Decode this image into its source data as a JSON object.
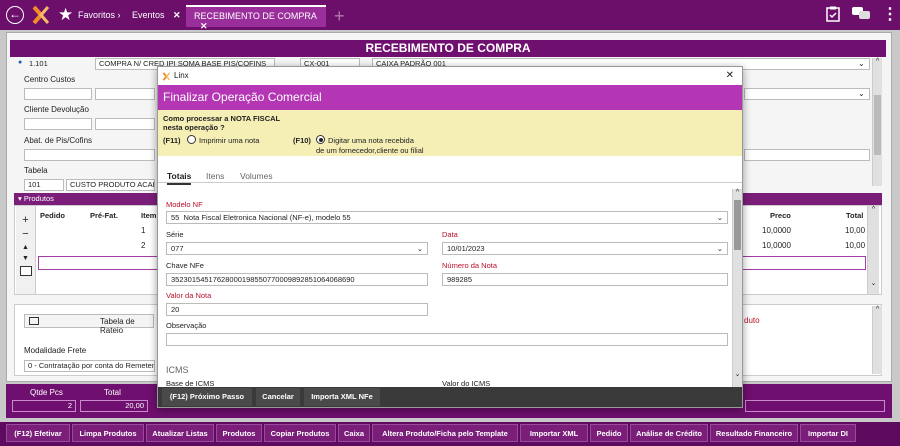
{
  "topbar": {
    "favoritos": "Favoritos",
    "favoritos_arrow": "›",
    "eventos": "Eventos",
    "tab_active": "RECEBIMENTO DE COMPRA",
    "tab_close": "✕",
    "eventos_close": "✕",
    "plus": "+"
  },
  "main": {
    "title": "RECEBIMENTO DE COMPRA",
    "row1": {
      "code": "1.101",
      "operacao": "COMPRA N/ CRED IPI SOMA BASE PIS/COFINS",
      "caixa_code": "CX-001",
      "caixa_name": "CAIXA PADRÃO 001"
    },
    "labels": {
      "centro_custos": "Centro Custos",
      "cliente_devolucao": "Cliente Devolução",
      "abat": "Abat. de Pis/Cofins",
      "tabela": "Tabela",
      "modalidade": "Modalidade Frete",
      "tabela_rateio": "Tabela de Rateio",
      "produto": "duto"
    },
    "tabela_code": "101",
    "tabela_name": "CUSTO PRODUTO ACABADO",
    "modalidade_value": "0 - Contratação por conta do Remetente (CIF)",
    "produtos": {
      "header": "Produtos",
      "columns": {
        "pedido": "Pedido",
        "prefat": "Pré-Fat.",
        "item": "Item",
        "preco": "Preco",
        "total": "Total"
      },
      "rows": [
        {
          "item": "1",
          "preco": "10,0000",
          "total": "10,00"
        },
        {
          "item": "2",
          "preco": "10,0000",
          "total": "10,00"
        }
      ]
    },
    "totals": {
      "qtde_label": "Qtde Pcs",
      "qtde_value": "2",
      "total_label": "Total",
      "total_value": "20,00"
    }
  },
  "modal": {
    "app": "Linx",
    "close": "✕",
    "header": "Finalizar Operação Comercial",
    "question_l1": "Como processar a NOTA FISCAL",
    "question_l2": "nesta operação ?",
    "opt1_key": "(F11)",
    "opt1_label": "Imprimir uma nota",
    "opt2_key": "(F10)",
    "opt2_l1": "Digitar uma nota recebida",
    "opt2_l2": "de um fornecedor,cliente ou filial",
    "tabs": [
      "Totais",
      "Itens",
      "Volumes"
    ],
    "fields": {
      "modelo_label": "Modelo NF",
      "modelo_code": "55",
      "modelo_value": "Nota Fiscal Eletronica Nacional (NF-e), modelo 55",
      "serie_label": "Série",
      "serie_value": "077",
      "data_label": "Data",
      "data_value": "10/01/2023",
      "chave_label": "Chave NFe",
      "chave_value": "35230154517628000198550770009892851064068690",
      "numero_label": "Número da Nota",
      "numero_value": "989285",
      "valor_label": "Valor da Nota",
      "valor_value": "20",
      "obs_label": "Observação",
      "icms_section": "ICMS",
      "base_icms": "Base de ICMS",
      "valor_icms": "Valor do ICMS"
    },
    "buttons": {
      "proximo": "(F12) Próximo Passo",
      "cancelar": "Cancelar",
      "importa": "Importa XML NFe"
    }
  },
  "footer": [
    "(F12) Efetivar",
    "Limpa Produtos",
    "Atualizar Listas",
    "Produtos",
    "Copiar Produtos",
    "Caixa",
    "Altera Produto/Ficha pelo Template",
    "Importar XML",
    "Pedido",
    "Análise de Crédito",
    "Resultado Financeiro",
    "Importar DI"
  ],
  "colors": {
    "brand": "#6b0f6b",
    "modal_header": "#b436b4",
    "question_bg": "#f5eeb5",
    "required": "#b8102b"
  }
}
